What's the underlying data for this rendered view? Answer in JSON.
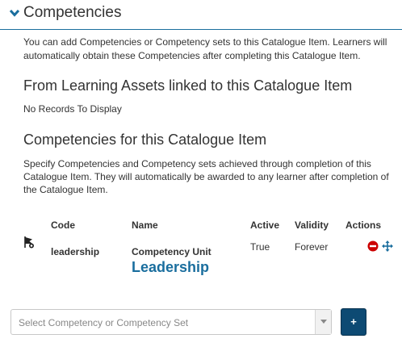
{
  "section": {
    "title": "Competencies",
    "icon": "chevron-down-icon",
    "intro": "You can add Competencies or Competency sets to this Catalogue Item. Learners will automatically obtain these Competencies after completing this Catalogue Item."
  },
  "learning_assets": {
    "heading": "From Learning Assets linked to this Catalogue Item",
    "empty_text": "No Records To Display"
  },
  "catalogue_competencies": {
    "heading": "Competencies for this Catalogue Item",
    "description": "Specify Competencies and Competency sets achieved through completion of this Catalogue Item. They will automatically be awarded to any learner after completion of the Catalogue Item.",
    "table": {
      "columns": [
        "Code",
        "Name",
        "Active",
        "Validity",
        "Actions"
      ],
      "rows": [
        {
          "type_icon": "competency-flag-icon",
          "code": "leadership",
          "name_type": "Competency Unit",
          "name": "Leadership",
          "active": "True",
          "validity": "Forever",
          "actions": [
            "remove-icon",
            "move-icon"
          ]
        }
      ]
    }
  },
  "add_row": {
    "placeholder": "Select Competency or Competency Set",
    "add_label": "+"
  },
  "colors": {
    "accent": "#1a6e9e",
    "add_button": "#0d4a73",
    "remove": "#cc0000"
  }
}
